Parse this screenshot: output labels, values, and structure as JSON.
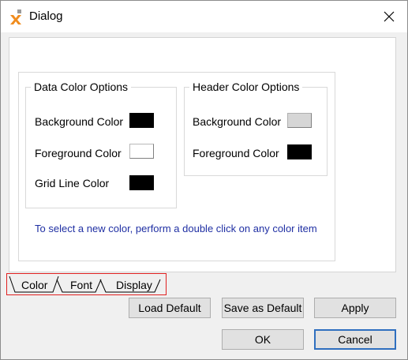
{
  "window": {
    "title": "Dialog"
  },
  "data_group": {
    "title": "Data Color Options",
    "items": [
      {
        "label": "Background Color",
        "color": "#000000"
      },
      {
        "label": "Foreground Color",
        "color": "#ffffff"
      },
      {
        "label": "Grid Line Color",
        "color": "#000000"
      }
    ]
  },
  "header_group": {
    "title": "Header Color Options",
    "items": [
      {
        "label": "Background Color",
        "color": "#d6d6d6"
      },
      {
        "label": "Foreground Color",
        "color": "#000000"
      }
    ]
  },
  "hint": "To select a new color, perform a double click on any color item",
  "tabs": [
    {
      "label": "Color",
      "selected": true
    },
    {
      "label": "Font",
      "selected": false
    },
    {
      "label": "Display",
      "selected": false
    }
  ],
  "buttons": {
    "load_default": "Load Default",
    "save_default": "Save as Default",
    "apply": "Apply",
    "ok": "OK",
    "cancel": "Cancel"
  },
  "icons": {
    "app": "x-app-icon",
    "close": "close-icon"
  },
  "colors": {
    "hint_text": "#1f2fa3",
    "tab_highlight": "#e02020",
    "default_button_border": "#2f6fbf"
  }
}
